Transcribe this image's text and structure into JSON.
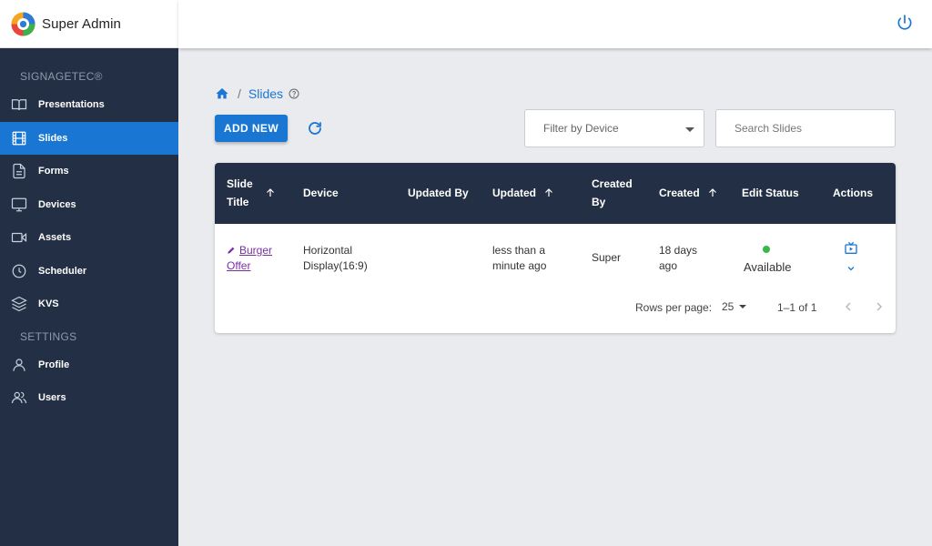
{
  "app": {
    "name": "Super Admin"
  },
  "sidebar": {
    "sections": [
      {
        "label": "SIGNAGETEC®",
        "items": [
          {
            "label": "Presentations",
            "icon": "book-open-icon",
            "active": false
          },
          {
            "label": "Slides",
            "icon": "film-icon",
            "active": true
          },
          {
            "label": "Forms",
            "icon": "document-icon",
            "active": false
          },
          {
            "label": "Devices",
            "icon": "monitor-icon",
            "active": false
          },
          {
            "label": "Assets",
            "icon": "video-camera-icon",
            "active": false
          },
          {
            "label": "Scheduler",
            "icon": "clock-icon",
            "active": false
          },
          {
            "label": "KVS",
            "icon": "layers-icon",
            "active": false
          }
        ]
      },
      {
        "label": "SETTINGS",
        "items": [
          {
            "label": "Profile",
            "icon": "user-icon",
            "active": false
          },
          {
            "label": "Users",
            "icon": "users-icon",
            "active": false
          }
        ]
      }
    ]
  },
  "breadcrumb": {
    "current": "Slides"
  },
  "toolbar": {
    "add_label": "ADD NEW",
    "filter_placeholder": "Filter by Device",
    "search_placeholder": "Search Slides"
  },
  "table": {
    "headers": {
      "slide_title": "Slide Title",
      "device": "Device",
      "updated_by": "Updated By",
      "updated": "Updated",
      "created_by": "Created By",
      "created": "Created",
      "edit_status": "Edit Status",
      "actions": "Actions"
    },
    "rows": [
      {
        "slide_title": "Burger Offer",
        "device": "Horizontal Display(16:9)",
        "updated_by": "",
        "updated": "less than a minute ago",
        "created_by": "Super",
        "created": "18 days ago",
        "edit_status": "Available"
      }
    ],
    "footer": {
      "rows_per_page_label": "Rows per page:",
      "rows_per_page": "25",
      "range": "1–1 of 1"
    }
  },
  "colors": {
    "sidebar_bg": "#232f45",
    "accent": "#1976d2",
    "link": "#7b2fa5",
    "status_available": "#36b84b"
  }
}
